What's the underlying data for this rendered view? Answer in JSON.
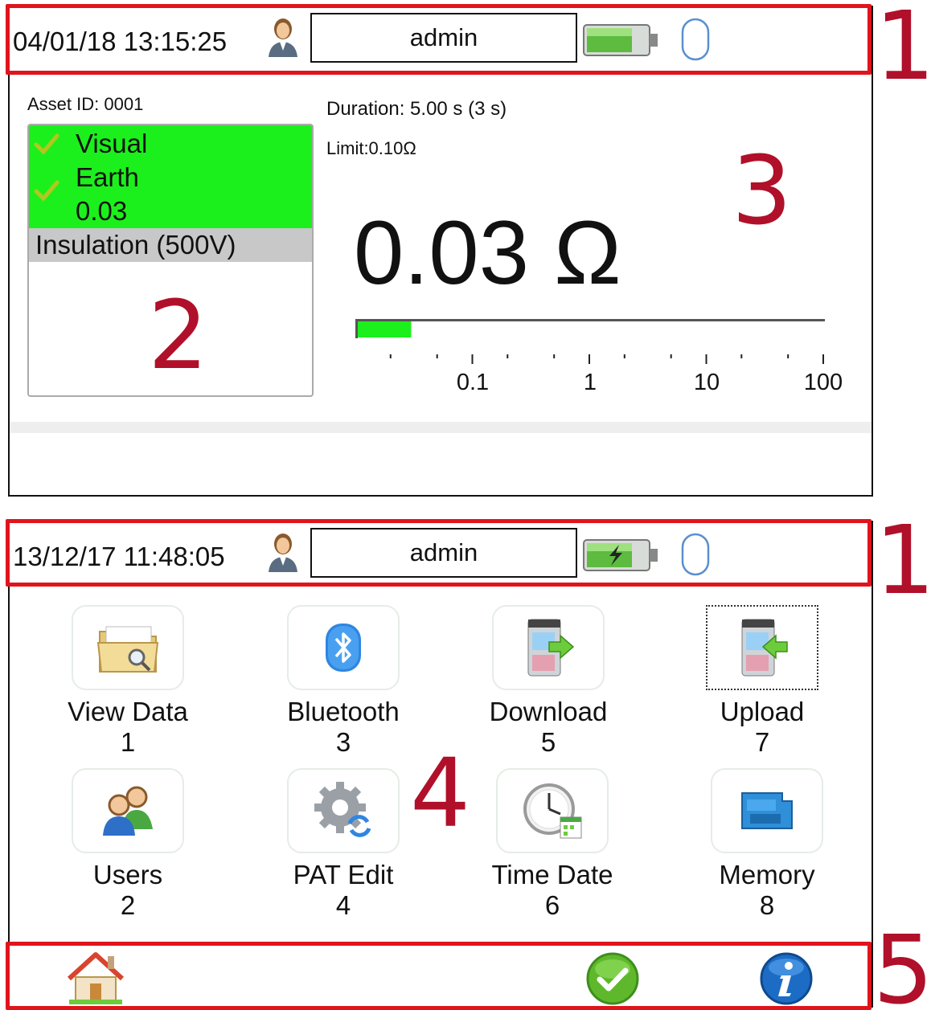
{
  "screen1": {
    "datetime": "04/01/18 13:15:25",
    "user": "admin",
    "battery_state": "full",
    "asset_label": "Asset ID: 0001",
    "tests": {
      "passed": [
        "Visual",
        "Earth",
        "0.03"
      ],
      "current": "Insulation (500V)"
    },
    "duration": "Duration:  5.00  s  (3 s)",
    "limit": "Limit:0.10Ω",
    "reading": "0.03 Ω",
    "scale_labels": [
      "0.1",
      "1",
      "10",
      "100"
    ],
    "bar_fill_value": 0.03
  },
  "screen2": {
    "datetime": "13/12/17 11:48:05",
    "user": "admin",
    "battery_state": "charging",
    "menu": [
      {
        "label": "View Data",
        "num": "1",
        "icon": "folder-search-icon"
      },
      {
        "label": "Bluetooth",
        "num": "3",
        "icon": "bluetooth-icon"
      },
      {
        "label": "Download",
        "num": "5",
        "icon": "download-device-icon"
      },
      {
        "label": "Upload",
        "num": "7",
        "icon": "upload-device-icon",
        "selected": true
      },
      {
        "label": "Users",
        "num": "2",
        "icon": "users-icon"
      },
      {
        "label": "PAT Edit",
        "num": "4",
        "icon": "gear-edit-icon"
      },
      {
        "label": "Time Date",
        "num": "6",
        "icon": "clock-calendar-icon"
      },
      {
        "label": "Memory",
        "num": "8",
        "icon": "microsd-icon"
      }
    ],
    "footer": [
      "home-icon",
      "ok-icon",
      "info-icon"
    ]
  },
  "annotations": [
    "1",
    "2",
    "3",
    "1",
    "4",
    "5"
  ],
  "colors": {
    "annotation": "#e0141c",
    "annotation_text": "#b0102a",
    "pass_green": "#1cf01c",
    "pending_grey": "#c8c8c8"
  }
}
